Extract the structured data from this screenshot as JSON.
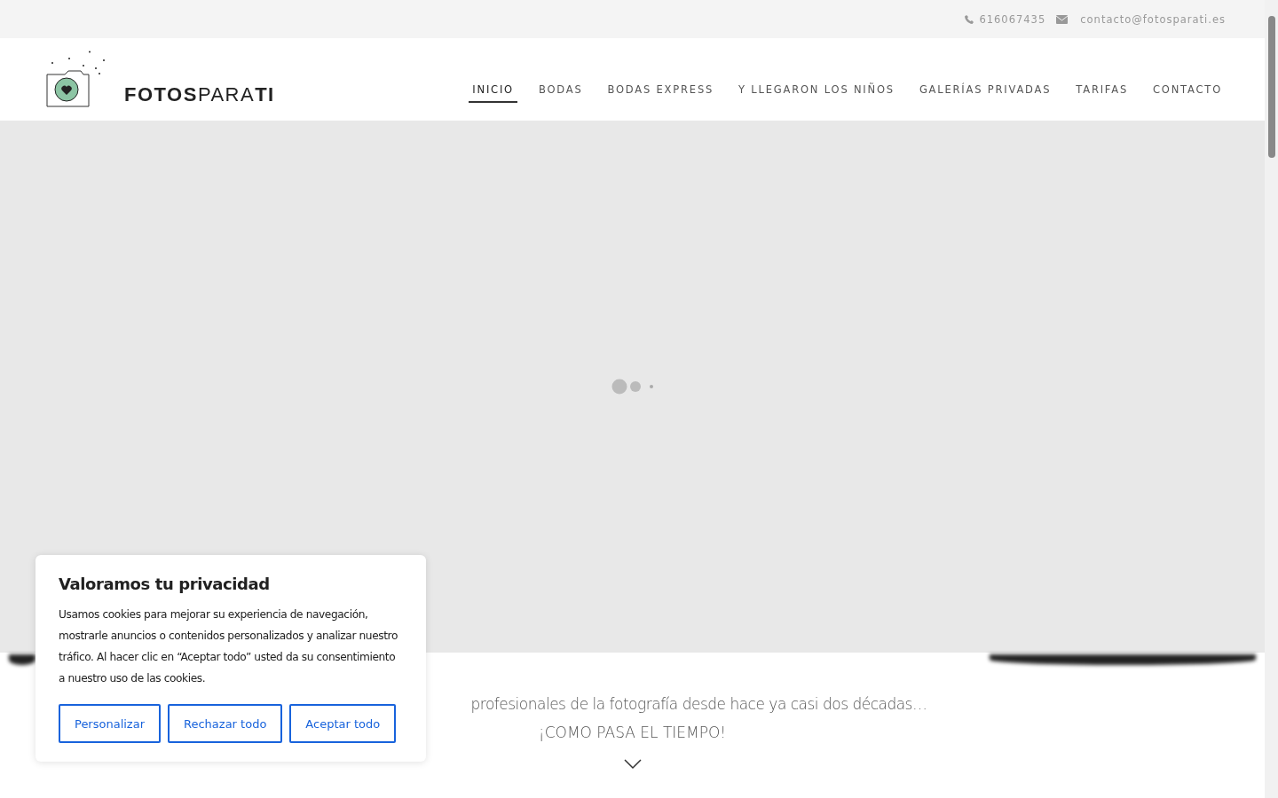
{
  "topbar": {
    "phone": "616067435",
    "email": "contacto@fotosparati.es"
  },
  "logo": {
    "bold": "FOTOS",
    "light": "PARA",
    "bold_end": "TI"
  },
  "nav": [
    {
      "label": "INICIO",
      "selected": true
    },
    {
      "label": "BODAS",
      "selected": false
    },
    {
      "label": "BODAS EXPRESS",
      "selected": false
    },
    {
      "label": "Y LLEGARON LOS NIÑOS",
      "selected": false
    },
    {
      "label": "GALERÍAS PRIVADAS",
      "selected": false
    },
    {
      "label": "TARIFAS",
      "selected": false
    },
    {
      "label": "CONTACTO",
      "selected": false
    }
  ],
  "intro": {
    "line_1": "profesionales de la fotografía desde hace ya casi dos décadas…",
    "line_2": "¡COMO PASA EL TIEMPO!"
  },
  "cookie_banner": {
    "title": "Valoramos tu privacidad",
    "text": "Usamos cookies para mejorar su experiencia de navegación, mostrarle anuncios o contenidos personalizados y analizar nuestro tráfico. Al hacer clic en “Aceptar todo” usted da su consentimiento a nuestro uso de las cookies.",
    "buttons": [
      "Personalizar",
      "Rechazar todo",
      "Aceptar todo"
    ]
  }
}
